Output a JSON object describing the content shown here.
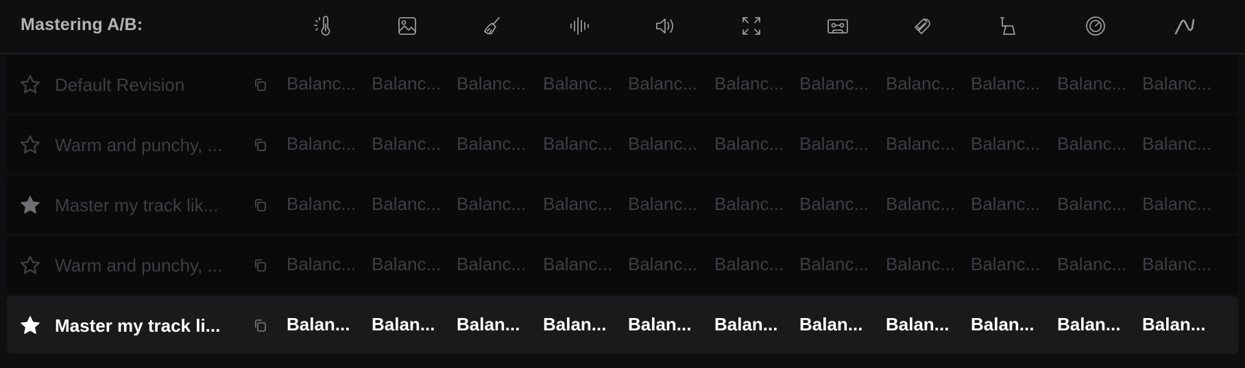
{
  "header": {
    "title": "Mastering A/B:",
    "icons": [
      "thermometer-icon",
      "image-icon",
      "broom-icon",
      "waveform-icon",
      "speaker-icon",
      "expand-icon",
      "cassette-icon",
      "magnet-icon",
      "lamp-icon",
      "gauge-icon",
      "curve-icon"
    ]
  },
  "rows": [
    {
      "name": "Default Revision",
      "starred": false,
      "active": false,
      "cells": [
        "Balanc...",
        "Balanc...",
        "Balanc...",
        "Balanc...",
        "Balanc...",
        "Balanc...",
        "Balanc...",
        "Balanc...",
        "Balanc...",
        "Balanc...",
        "Balanc..."
      ]
    },
    {
      "name": "Warm and punchy, ...",
      "starred": false,
      "active": false,
      "cells": [
        "Balanc...",
        "Balanc...",
        "Balanc...",
        "Balanc...",
        "Balanc...",
        "Balanc...",
        "Balanc...",
        "Balanc...",
        "Balanc...",
        "Balanc...",
        "Balanc..."
      ]
    },
    {
      "name": "Master my track lik...",
      "starred": true,
      "active": false,
      "cells": [
        "Balanc...",
        "Balanc...",
        "Balanc...",
        "Balanc...",
        "Balanc...",
        "Balanc...",
        "Balanc...",
        "Balanc...",
        "Balanc...",
        "Balanc...",
        "Balanc..."
      ]
    },
    {
      "name": "Warm and punchy, ...",
      "starred": false,
      "active": false,
      "cells": [
        "Balanc...",
        "Balanc...",
        "Balanc...",
        "Balanc...",
        "Balanc...",
        "Balanc...",
        "Balanc...",
        "Balanc...",
        "Balanc...",
        "Balanc...",
        "Balanc..."
      ]
    },
    {
      "name": "Master my track li...",
      "starred": true,
      "active": true,
      "cells": [
        "Balan...",
        "Balan...",
        "Balan...",
        "Balan...",
        "Balan...",
        "Balan...",
        "Balan...",
        "Balan...",
        "Balan...",
        "Balan...",
        "Balan..."
      ]
    }
  ]
}
